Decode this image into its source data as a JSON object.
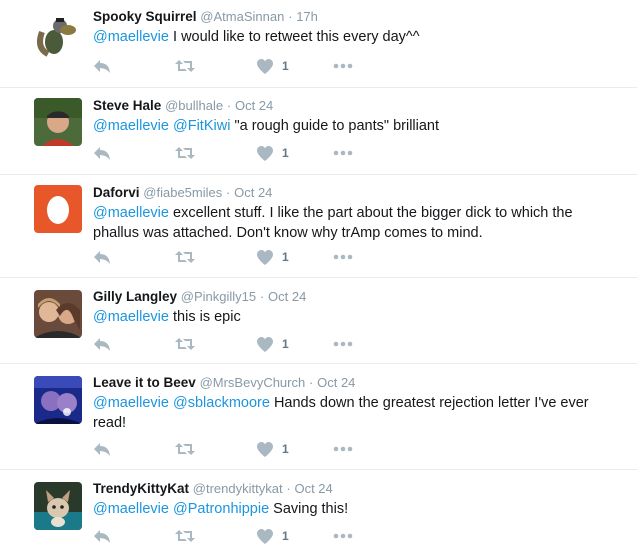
{
  "colors": {
    "accent": "#1b95e0",
    "icon": "#aab8c2",
    "border": "#e6ecf0",
    "muted": "#8899a6"
  },
  "icons": {
    "reply": "reply-icon",
    "retweet": "retweet-icon",
    "like": "heart-icon",
    "more": "more-icon"
  },
  "tweets": [
    {
      "name": "Spooky Squirrel",
      "handle": "@AtmaSinnan",
      "sep": "·",
      "time": "17h",
      "mentions": "@maellevie",
      "text": " I would like to retweet this every day^^",
      "line2": "",
      "likes": "1"
    },
    {
      "name": "Steve Hale",
      "handle": "@bullhale",
      "sep": "·",
      "time": "Oct 24",
      "mentions": "@maellevie @FitKiwi",
      "text": " \"a rough guide to pants\" brilliant",
      "line2": "",
      "likes": "1"
    },
    {
      "name": "Daforvi",
      "handle": "@fiabe5miles",
      "sep": "·",
      "time": "Oct 24",
      "mentions": "@maellevie",
      "text": " excellent stuff. I like the part about the bigger dick to which the",
      "line2": "phallus was attached. Don't know why trAmp comes to mind.",
      "likes": "1"
    },
    {
      "name": "Gilly Langley",
      "handle": "@Pinkgilly15",
      "sep": "·",
      "time": "Oct 24",
      "mentions": "@maellevie",
      "text": " this is epic",
      "line2": "",
      "likes": "1"
    },
    {
      "name": "Leave it to Beev",
      "handle": "@MrsBevyChurch",
      "sep": "·",
      "time": "Oct 24",
      "mentions": "@maellevie @sblackmoore",
      "text": " Hands down the greatest rejection letter I've ever",
      "line2": "read!",
      "likes": "1"
    },
    {
      "name": "TrendyKittyKat",
      "handle": "@trendykittykat",
      "sep": "·",
      "time": "Oct 24",
      "mentions": "@maellevie @Patronhippie",
      "text": " Saving this!",
      "line2": "",
      "likes": "1"
    }
  ]
}
